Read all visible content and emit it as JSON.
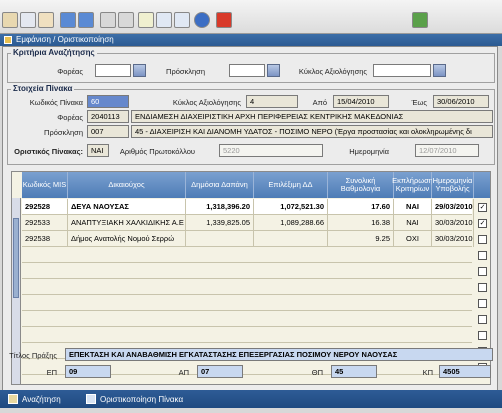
{
  "window": {
    "title": "Εμφάνιση / Οριστικοποίηση"
  },
  "search": {
    "legend": "Κριτήρια Αναζήτησης",
    "foreis_label": "Φορέας",
    "prosklisi_label": "Πρόσκληση",
    "kyklos_label": "Κύκλος Αξιολόγησης"
  },
  "table_info": {
    "legend": "Στοιχεία Πίνακα",
    "kodikos_label": "Κωδικός Πίνακα",
    "kodikos_value": "60",
    "kyklos_label": "Κύκλος Αξιολόγησης",
    "kyklos_value": "4",
    "apo_label": "Από",
    "apo_value": "15/04/2010",
    "eos_label": "Έως",
    "eos_value": "30/06/2010",
    "foreas_label": "Φορέας",
    "foreas_code": "2040113",
    "foreas_name": "ΕΝΔΙΑΜΕΣΗ ΔΙΑΧΕΙΡΙΣΤΙΚΗ ΑΡΧΗ ΠΕΡΙΦΕΡΕΙΑΣ ΚΕΝΤΡΙΚΗΣ ΜΑΚΕΔΟΝΙΑΣ",
    "prosklisi_label": "Πρόσκληση",
    "prosklisi_code": "007",
    "prosklisi_name": "45 - ΔΙΑΧΕΙΡΙΣΗ ΚΑΙ ΔΙΑΝΟΜΗ ΥΔΑΤΟΣ - ΠΟΣΙΜΟ ΝΕΡΟ (Έργα προστασίας και ολοκληρωμένης δι",
    "oristikos_label": "Οριστικός Πίνακας:",
    "oristikos_value": "ΝΑΙ",
    "protokollo_label": "Αριθμός Πρωτοκόλλου",
    "protokollo_value": "5220",
    "imerominia_label": "Ημερομηνία",
    "imerominia_value": "12/07/2010"
  },
  "grid": {
    "headers": [
      "Κωδικός MIS",
      "Δικαιούχος",
      "Δημόσια Δαπάνη",
      "Επιλέξιμη ΔΔ",
      "Συνολική Βαθμολογία",
      "Εκπλήρωση Κριτηρίων",
      "Ημερομηνία Υποβολής"
    ],
    "rows": [
      {
        "mis": "292528",
        "dikaiouxos": "ΔΕΥΑ ΝΑΟΥΣΑΣ",
        "dapani": "1,318,396.20",
        "epileximi": "1,072,521.30",
        "vathmologia": "17.60",
        "ekplirosi": "ΝΑΙ",
        "imerominia": "29/03/2010",
        "checked": "✓"
      },
      {
        "mis": "292533",
        "dikaiouxos": "ΑΝΑΠΤΥΞΙΑΚΗ ΧΑΛΚΙΔΙΚΗΣ Α.Ε",
        "dapani": "1,339,825.05",
        "epileximi": "1,089,288.66",
        "vathmologia": "16.38",
        "ekplirosi": "ΝΑΙ",
        "imerominia": "30/03/2010",
        "checked": "✓"
      },
      {
        "mis": "292538",
        "dikaiouxos": "Δήμος Ανατολής Νομού Σερρώ",
        "dapani": "",
        "epileximi": "",
        "vathmologia": "9.25",
        "ekplirosi": "ΟΧΙ",
        "imerominia": "30/03/2010",
        "checked": ""
      }
    ]
  },
  "project": {
    "titlos_label": "Τίτλος Πράξης",
    "titlos_value": "ΕΠΕΚΤΑΣΗ ΚΑΙ ΑΝΑΒΑΘΜΙΣΗ ΕΓΚΑΤΑΣΤΑΣΗΣ ΕΠΕΞΕΡΓΑΣΙΑΣ ΠΟΣΙΜΟΥ ΝΕΡΟΥ ΝΑΟΥΣΑΣ",
    "ep_label": "ΕΠ",
    "ep_value": "09",
    "ap_label": "ΑΠ",
    "ap_value": "07",
    "thp_label": "ΘΠ",
    "thp_value": "45",
    "kp_label": "ΚΠ",
    "kp_value": "4505"
  },
  "footer": {
    "search_label": "Αναζήτηση",
    "finalize_label": "Οριστικοποίηση Πίνακα"
  },
  "colors": {
    "header_blue": "#4e7cb6",
    "titlebar": "#2b5a92",
    "readonly": "#e9e6d8"
  }
}
